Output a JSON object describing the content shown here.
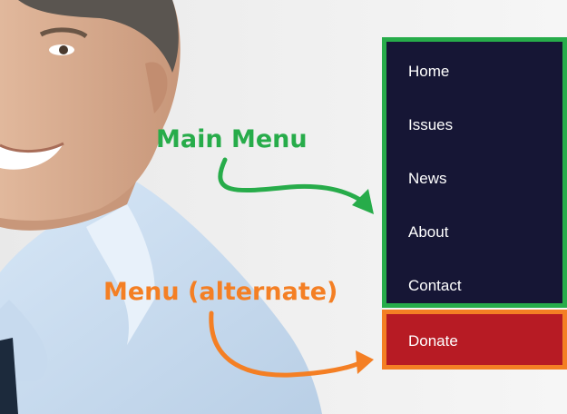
{
  "annotations": {
    "main_menu_label": "Main Menu",
    "alternate_menu_label": "Menu (alternate)"
  },
  "main_menu": {
    "items": [
      {
        "label": "Home"
      },
      {
        "label": "Issues"
      },
      {
        "label": "News"
      },
      {
        "label": "About"
      },
      {
        "label": "Contact"
      }
    ]
  },
  "alternate_menu": {
    "items": [
      {
        "label": "Donate"
      }
    ]
  },
  "colors": {
    "main_menu_bg": "#161635",
    "donate_bg": "#b71b24",
    "annotation_green": "#27ac4a",
    "annotation_orange": "#f47f24"
  }
}
